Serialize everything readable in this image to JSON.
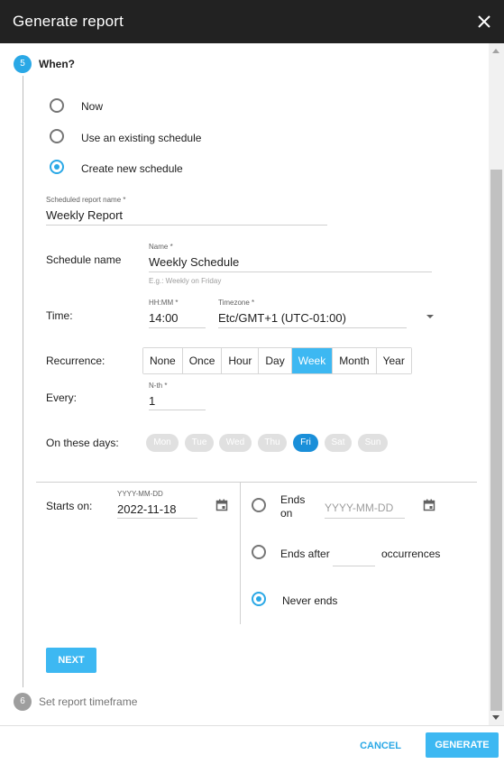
{
  "dialog": {
    "title": "Generate report",
    "close_icon": "close-icon"
  },
  "steps": [
    {
      "number": "5",
      "title": "When?",
      "state": "active"
    },
    {
      "number": "6",
      "title": "Set report timeframe",
      "state": "inactive"
    }
  ],
  "when_options": [
    {
      "label": "Now",
      "checked": false
    },
    {
      "label": "Use an existing schedule",
      "checked": false
    },
    {
      "label": "Create new schedule",
      "checked": true
    }
  ],
  "report_name": {
    "label": "Scheduled report name *",
    "value": "Weekly Report"
  },
  "schedule_name": {
    "row_label": "Schedule name",
    "label": "Name *",
    "value": "Weekly Schedule",
    "hint": "E.g.: Weekly on Friday"
  },
  "time": {
    "row_label": "Time:",
    "time_label": "HH:MM *",
    "time_value": "14:00",
    "tz_label": "Timezone *",
    "tz_value": "Etc/GMT+1 (UTC-01:00)"
  },
  "recurrence": {
    "row_label": "Recurrence:",
    "options": [
      "None",
      "Once",
      "Hour",
      "Day",
      "Week",
      "Month",
      "Year"
    ],
    "selected": "Week"
  },
  "every": {
    "row_label": "Every:",
    "label": "N-th *",
    "value": "1"
  },
  "days": {
    "row_label": "On these days:",
    "items": [
      "Mon",
      "Tue",
      "Wed",
      "Thu",
      "Fri",
      "Sat",
      "Sun"
    ],
    "selected": "Fri"
  },
  "starts_on": {
    "row_label": "Starts on:",
    "label": "YYYY-MM-DD",
    "value": "2022-11-18"
  },
  "ends": {
    "on_label_line1": "Ends",
    "on_label_line2": "on",
    "on_placeholder": "YYYY-MM-DD",
    "after_label": "Ends after",
    "after_suffix": "occurrences",
    "never_label": "Never ends",
    "selected": "never"
  },
  "buttons": {
    "next": "NEXT",
    "cancel": "CANCEL",
    "generate": "GENERATE"
  },
  "colors": {
    "accent": "#3db8f2",
    "title_bar": "#222222",
    "selected_day": "#1a8fd9"
  }
}
